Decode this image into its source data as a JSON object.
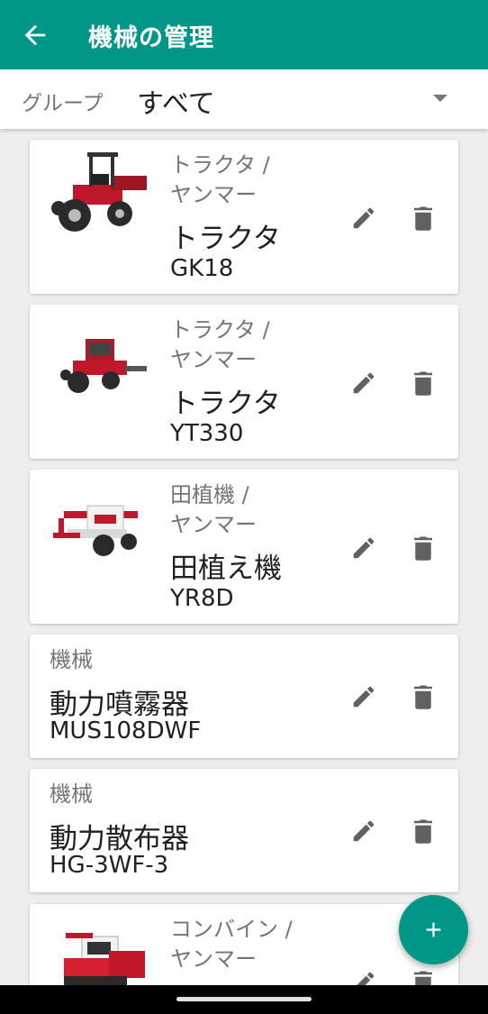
{
  "appbar": {
    "title": "機械の管理",
    "back_icon": "arrow-left-icon"
  },
  "group": {
    "label": "グループ",
    "value": "すべて"
  },
  "colors": {
    "primary": "#009688",
    "icon": "#757575"
  },
  "machines": [
    {
      "category": "トラクタ  /",
      "maker": "ヤンマー",
      "name": "トラクタ",
      "model": "GK18",
      "has_image": true
    },
    {
      "category": "トラクタ  /",
      "maker": "ヤンマー",
      "name": "トラクタ",
      "model": "YT330",
      "has_image": true
    },
    {
      "category": "田植機  /",
      "maker": "ヤンマー",
      "name": "田植え機",
      "model": "YR8D",
      "has_image": true
    },
    {
      "category": "機械",
      "maker": "",
      "name": "動力噴霧器",
      "model": "MUS108DWF",
      "has_image": false
    },
    {
      "category": "機械",
      "maker": "",
      "name": "動力散布器",
      "model": "HG-3WF-3",
      "has_image": false
    },
    {
      "category": "コンバイン  /",
      "maker": "ヤンマー",
      "name": "",
      "model": "",
      "has_image": true
    }
  ],
  "fab": {
    "icon": "plus-icon"
  }
}
